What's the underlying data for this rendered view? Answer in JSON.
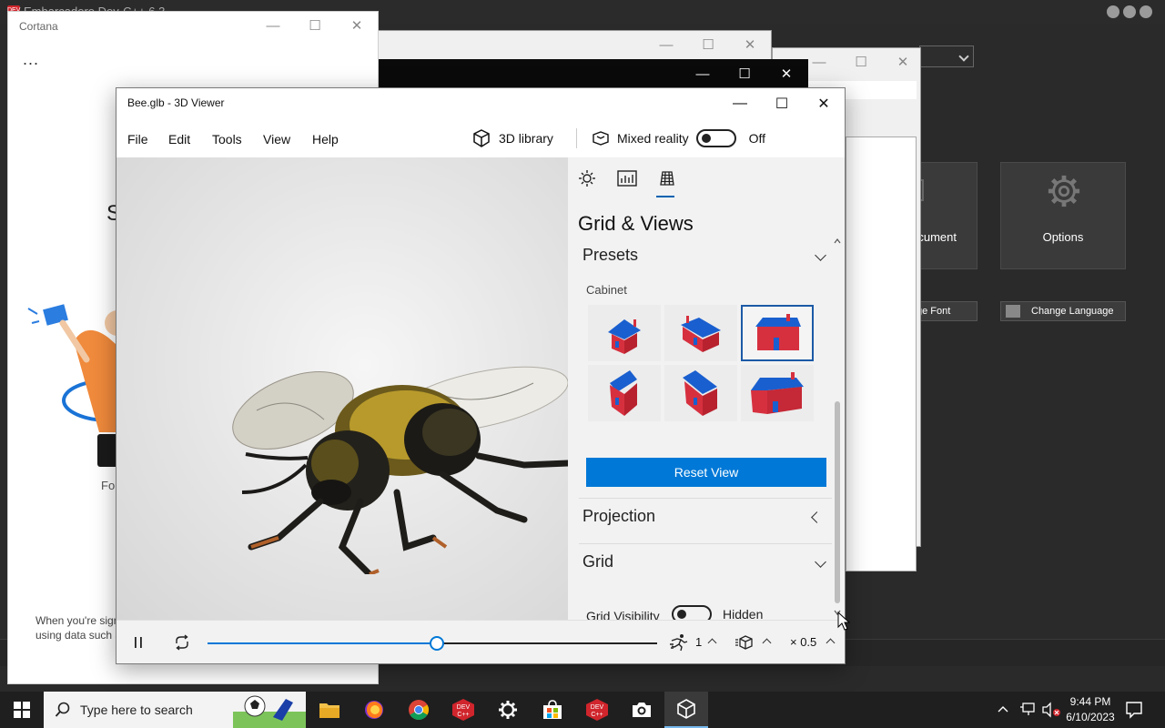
{
  "background_app": {
    "title": "Embarcadero Dev-C++ 6.3",
    "tile_document_label": "cument",
    "tile_options_label": "Options",
    "btn_font_label": "ge Font",
    "btn_language_label": "Change Language"
  },
  "cortana": {
    "title": "Cortana",
    "menu_dots": "...",
    "big_letter": "S",
    "for_text": "For",
    "note_line1": "When you're sign",
    "note_line2": "using data such a"
  },
  "viewer": {
    "title": "Bee.glb - 3D Viewer",
    "menu": [
      "File",
      "Edit",
      "Tools",
      "View",
      "Help"
    ],
    "library_label": "3D library",
    "mixed_reality_label": "Mixed reality",
    "mixed_reality_state": "Off",
    "panel": {
      "tabs": [
        "lighting-icon",
        "stats-icon",
        "grid-icon"
      ],
      "active_tab": 2,
      "title": "Grid & Views",
      "presets_header": "Presets",
      "preset_group_label": "Cabinet",
      "preset_selected_index": 2,
      "reset_label": "Reset View",
      "projection_header": "Projection",
      "grid_header": "Grid",
      "grid_visibility_label": "Grid Visibility",
      "grid_visibility_state": "Hidden"
    },
    "playback": {
      "progress": 0.51,
      "animation_count": "1",
      "speed": "× 0.5"
    }
  },
  "taskbar": {
    "search_placeholder": "Type here to search",
    "time": "9:44 PM",
    "date": "6/10/2023",
    "accent": "#76b9ed"
  },
  "colors": {
    "accent_blue": "#0078d7",
    "house_red": "#d6303f",
    "house_blue": "#1a5fcf"
  }
}
